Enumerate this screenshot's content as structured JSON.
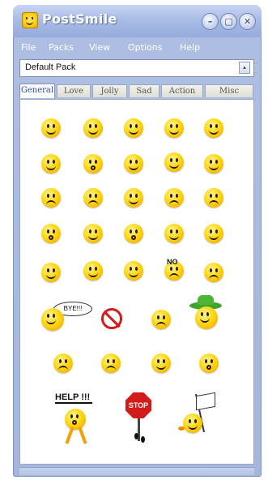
{
  "window": {
    "title": "PostSmile",
    "controls": {
      "minimize": "–",
      "restore": "▢",
      "close": "✕"
    }
  },
  "menu": [
    "File",
    "Packs",
    "View",
    "Options",
    "Help"
  ],
  "pack_selector": {
    "value": "Default Pack",
    "button": "▴"
  },
  "tabs": [
    "General",
    "Love",
    "Jolly",
    "Sad",
    "Action",
    "Misc"
  ],
  "active_tab": "General",
  "emoticons": {
    "bubble_text": "BYE!!!",
    "help_text": "HELP !!!",
    "stop_text": "STOP",
    "no_text": "NO"
  },
  "colors": {
    "accent": "#2b4fb2",
    "smiley": "#ffd812"
  }
}
